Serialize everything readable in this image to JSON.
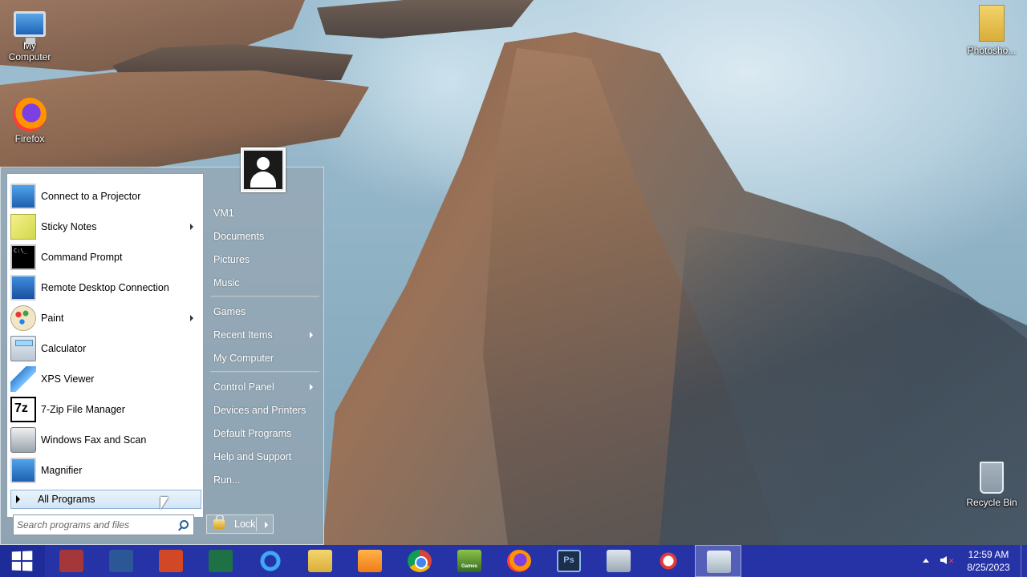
{
  "desktop": {
    "icons": [
      {
        "label": "My\nComputer",
        "icon": "monitor-icon"
      },
      {
        "label": "Firefox",
        "icon": "firefox-icon"
      },
      {
        "label": "Photosho...",
        "icon": "folder-icon"
      },
      {
        "label": "Recycle Bin",
        "icon": "recycle-bin-icon"
      }
    ]
  },
  "start_menu": {
    "programs": [
      {
        "label": "Connect to a Projector",
        "icon": "projector-icon",
        "has_submenu": false
      },
      {
        "label": "Sticky Notes",
        "icon": "sticky-notes-icon",
        "has_submenu": true
      },
      {
        "label": "Command Prompt",
        "icon": "command-prompt-icon",
        "has_submenu": false
      },
      {
        "label": "Remote Desktop Connection",
        "icon": "remote-desktop-icon",
        "has_submenu": false
      },
      {
        "label": "Paint",
        "icon": "paint-icon",
        "has_submenu": true
      },
      {
        "label": "Calculator",
        "icon": "calculator-icon",
        "has_submenu": false
      },
      {
        "label": "XPS Viewer",
        "icon": "xps-viewer-icon",
        "has_submenu": false
      },
      {
        "label": "7-Zip File Manager",
        "icon": "seven-zip-icon",
        "has_submenu": false
      },
      {
        "label": "Windows Fax and Scan",
        "icon": "fax-scan-icon",
        "has_submenu": false
      },
      {
        "label": "Magnifier",
        "icon": "magnifier-icon",
        "has_submenu": false
      }
    ],
    "all_programs_label": "All Programs",
    "search_placeholder": "Search programs and files",
    "right_items": [
      {
        "label": "VM1",
        "has_submenu": false
      },
      {
        "label": "Documents",
        "has_submenu": false
      },
      {
        "label": "Pictures",
        "has_submenu": false
      },
      {
        "label": "Music",
        "has_submenu": false
      },
      {
        "label": "Games",
        "has_submenu": false
      },
      {
        "label": "Recent Items",
        "has_submenu": true
      },
      {
        "label": "My Computer",
        "has_submenu": false
      },
      {
        "label": "Control Panel",
        "has_submenu": true
      },
      {
        "label": "Devices and Printers",
        "has_submenu": false
      },
      {
        "label": "Default Programs",
        "has_submenu": false
      },
      {
        "label": "Help and Support",
        "has_submenu": false
      },
      {
        "label": "Run...",
        "has_submenu": false
      }
    ],
    "lock_label": "Lock"
  },
  "taskbar": {
    "pinned": [
      {
        "app": "Access",
        "icon": "access-icon"
      },
      {
        "app": "Word",
        "icon": "word-icon"
      },
      {
        "app": "PowerPoint",
        "icon": "powerpoint-icon"
      },
      {
        "app": "Excel",
        "icon": "excel-icon"
      },
      {
        "app": "Internet Explorer",
        "icon": "internet-explorer-icon"
      },
      {
        "app": "File Explorer",
        "icon": "file-explorer-icon"
      },
      {
        "app": "Media Player",
        "icon": "media-player-icon"
      },
      {
        "app": "Chrome",
        "icon": "chrome-icon"
      },
      {
        "app": "Games",
        "icon": "games-icon"
      },
      {
        "app": "Firefox",
        "icon": "firefox-icon"
      },
      {
        "app": "Photoshop",
        "icon": "photoshop-icon"
      },
      {
        "app": "Network",
        "icon": "network-icon"
      },
      {
        "app": "Snipping Tool",
        "icon": "snipping-tool-icon"
      },
      {
        "app": "Disc Tool",
        "icon": "disc-icon"
      }
    ],
    "games_badge": "Games",
    "photoshop_badge": "Ps",
    "clock_time": "12:59 AM",
    "clock_date": "8/25/2023"
  },
  "colors": {
    "taskbar": "#2533a6",
    "start_button": "#1e2c9a",
    "all_programs_highlight": "#d3e6f6"
  }
}
